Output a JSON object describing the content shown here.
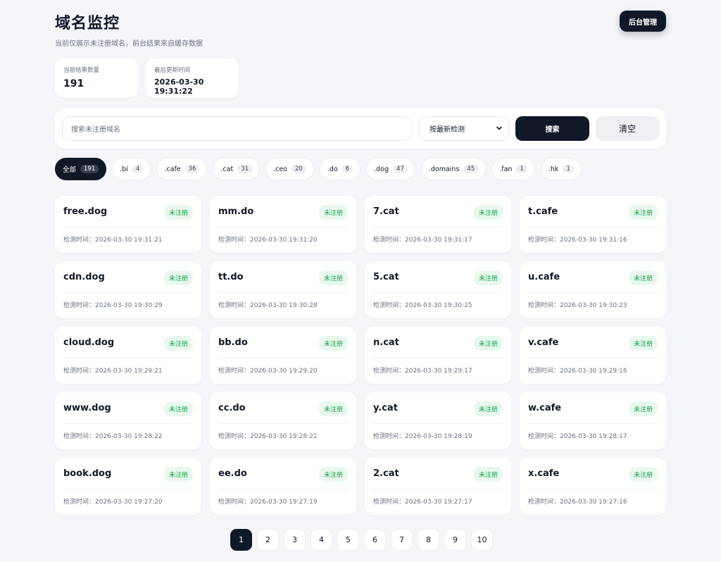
{
  "header": {
    "title": "域名监控",
    "subtitle": "当前仅展示未注册域名，前台结果来自缓存数据",
    "admin_button": "后台管理"
  },
  "stats": {
    "count_label": "当前结果数量",
    "count_value": "191",
    "updated_label": "最后更新时间",
    "updated_value": "2026-03-30 19:31:22"
  },
  "search": {
    "placeholder": "搜索未注册域名",
    "sort_selected": "按最新检测",
    "search_button": "搜索",
    "clear_button": "清空"
  },
  "filters": [
    {
      "label": "全部",
      "count": "191",
      "active": true
    },
    {
      "label": ".bi",
      "count": "4"
    },
    {
      "label": ".cafe",
      "count": "36"
    },
    {
      "label": ".cat",
      "count": "31"
    },
    {
      "label": ".ceo",
      "count": "20"
    },
    {
      "label": ".do",
      "count": "6"
    },
    {
      "label": ".dog",
      "count": "47"
    },
    {
      "label": ".domains",
      "count": "45"
    },
    {
      "label": ".fan",
      "count": "1"
    },
    {
      "label": ".hk",
      "count": "1"
    }
  ],
  "cards": [
    {
      "name": "free.dog",
      "status": "未注册",
      "time": "检测时间：2026-03-30 19:31:21"
    },
    {
      "name": "mm.do",
      "status": "未注册",
      "time": "检测时间：2026-03-30 19:31:20"
    },
    {
      "name": "7.cat",
      "status": "未注册",
      "time": "检测时间：2026-03-30 19:31:17"
    },
    {
      "name": "t.cafe",
      "status": "未注册",
      "time": "检测时间：2026-03-30 19:31:16"
    },
    {
      "name": "cdn.dog",
      "status": "未注册",
      "time": "检测时间：2026-03-30 19:30:29"
    },
    {
      "name": "tt.do",
      "status": "未注册",
      "time": "检测时间：2026-03-30 19:30:28"
    },
    {
      "name": "5.cat",
      "status": "未注册",
      "time": "检测时间：2026-03-30 19:30:25"
    },
    {
      "name": "u.cafe",
      "status": "未注册",
      "time": "检测时间：2026-03-30 19:30:23"
    },
    {
      "name": "cloud.dog",
      "status": "未注册",
      "time": "检测时间：2026-03-30 19:29:21"
    },
    {
      "name": "bb.do",
      "status": "未注册",
      "time": "检测时间：2026-03-30 19:29:20"
    },
    {
      "name": "n.cat",
      "status": "未注册",
      "time": "检测时间：2026-03-30 19:29:17"
    },
    {
      "name": "v.cafe",
      "status": "未注册",
      "time": "检测时间：2026-03-30 19:29:16"
    },
    {
      "name": "www.dog",
      "status": "未注册",
      "time": "检测时间：2026-03-30 19:28:22"
    },
    {
      "name": "cc.do",
      "status": "未注册",
      "time": "检测时间：2026-03-30 19:28:21"
    },
    {
      "name": "y.cat",
      "status": "未注册",
      "time": "检测时间：2026-03-30 19:28:19"
    },
    {
      "name": "w.cafe",
      "status": "未注册",
      "time": "检测时间：2026-03-30 19:28:17"
    },
    {
      "name": "book.dog",
      "status": "未注册",
      "time": "检测时间：2026-03-30 19:27:20"
    },
    {
      "name": "ee.do",
      "status": "未注册",
      "time": "检测时间：2026-03-30 19:27:19"
    },
    {
      "name": "2.cat",
      "status": "未注册",
      "time": "检测时间：2026-03-30 19:27:17"
    },
    {
      "name": "x.cafe",
      "status": "未注册",
      "time": "检测时间：2026-03-30 19:27:16"
    }
  ],
  "pagination": {
    "pages": [
      "1",
      "2",
      "3",
      "4",
      "5",
      "6",
      "7",
      "8",
      "9",
      "10"
    ],
    "current": "1"
  },
  "icons": {
    "sort_select": "chevron-down-icon"
  },
  "colors": {
    "accent": "#111827",
    "background": "#f5f6fa",
    "status_text": "#16a34a",
    "status_bg": "#e8f8ee"
  }
}
